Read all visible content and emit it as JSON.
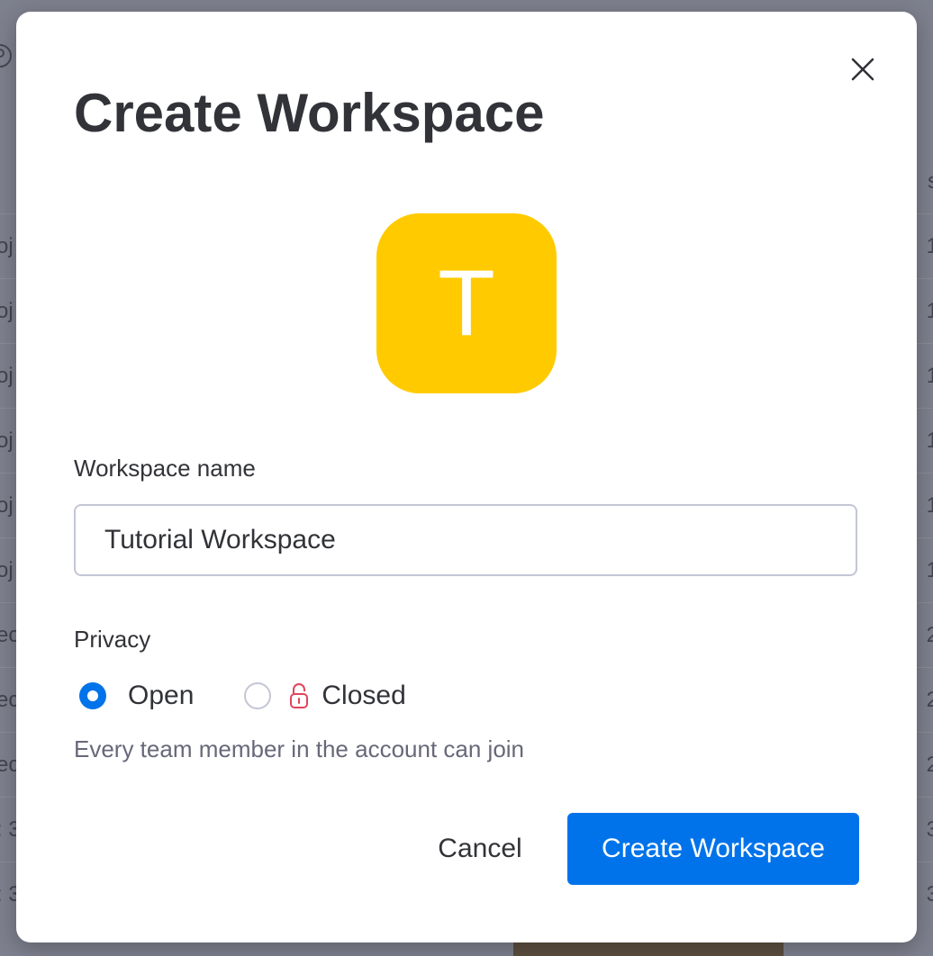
{
  "background": {
    "rows": [
      {
        "left": "oj",
        "right": "1"
      },
      {
        "left": "oj",
        "right": "1"
      },
      {
        "left": "oj",
        "right": "1"
      },
      {
        "left": "oj",
        "right": "1"
      },
      {
        "left": "oj",
        "right": "1"
      },
      {
        "left": "oj",
        "right": "1"
      },
      {
        "left": "ec",
        "right": "2"
      },
      {
        "left": "ec",
        "right": "2"
      },
      {
        "left": "ec",
        "right": "2"
      },
      {
        "left": ": 3",
        "right": "3"
      },
      {
        "left": ": 3",
        "right": "3"
      }
    ],
    "header_right": "s"
  },
  "modal": {
    "title": "Create Workspace",
    "avatar_letter": "T",
    "avatar_color": "#ffcb00",
    "name_label": "Workspace name",
    "name_value": "Tutorial Workspace",
    "privacy_label": "Privacy",
    "privacy_options": [
      {
        "label": "Open",
        "checked": true
      },
      {
        "label": "Closed",
        "checked": false,
        "icon": "lock-icon"
      }
    ],
    "privacy_hint": "Every team member in the account can join",
    "cancel_label": "Cancel",
    "create_label": "Create Workspace",
    "accent_color": "#0073ea"
  }
}
